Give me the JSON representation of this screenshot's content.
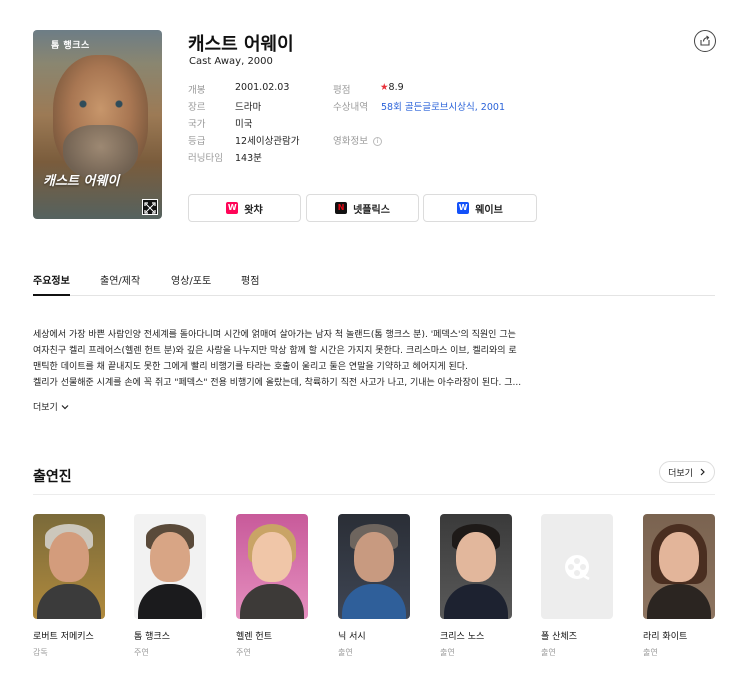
{
  "movie": {
    "title": "캐스트 어웨이",
    "subtitle": "Cast Away, 2000",
    "poster": {
      "top_text": "톰 행크스",
      "title_text": "캐스트 어웨이"
    },
    "info_left": [
      {
        "label": "개봉",
        "value": "2001.02.03"
      },
      {
        "label": "장르",
        "value": "드라마"
      },
      {
        "label": "국가",
        "value": "미국"
      },
      {
        "label": "등급",
        "value": "12세이상관람가"
      },
      {
        "label": "러닝타임",
        "value": "143분"
      }
    ],
    "info_right": {
      "rating_label": "평점",
      "rating_value": "8.9",
      "award_label": "수상내역",
      "award_value": "58회 골든글로브시상식, 2001",
      "movieinfo_label": "영화정보",
      "movieinfo_icon": "info-icon"
    }
  },
  "ott": [
    {
      "label": "왓챠",
      "logo": "W",
      "color": "#ff0558"
    },
    {
      "label": "넷플릭스",
      "logo": "N",
      "color": "#e50914"
    },
    {
      "label": "웨이브",
      "logo": "W",
      "color": "#1351f9"
    }
  ],
  "tabs": [
    "주요정보",
    "출연/제작",
    "영상/포토",
    "평점"
  ],
  "synopsis": {
    "lines": [
      "세상에서 가장 바쁜 사람인양 전세계를 돌아다니며 시간에 얽매여 살아가는 남자 척 놀랜드(톰 행크스 분). '페덱스'의 직원인 그는",
      "여자친구 켈리 프레어스(헬렌 헌트 분)와 깊은 사랑을 나누지만 막상 함께 할 시간은 가지지 못한다. 크리스마스 이브, 켈리와의 로",
      "맨틱한 데이트를 채 끝내지도 못한 그에게 빨리 비행기를 타라는 호출이 울리고 둘은 연말을 기약하고 헤어지게 된다.",
      "켈리가 선물해준 시계를 손에 꼭 쥐고 \"페덱스\" 전용 비행기에 올랐는데, 착륙하기 직전 사고가 나고, 기내는 아수라장이 된다. 그..."
    ],
    "more_label": "더보기"
  },
  "cast": {
    "heading": "출연진",
    "more_label": "더보기",
    "people": [
      {
        "name": "로버트 저메키스",
        "role": "감독"
      },
      {
        "name": "톰 행크스",
        "role": "주연"
      },
      {
        "name": "헬렌 헌트",
        "role": "주연"
      },
      {
        "name": "닉 서시",
        "role": "출연"
      },
      {
        "name": "크리스 노스",
        "role": "출연"
      },
      {
        "name": "폴 산체즈",
        "role": "출연"
      },
      {
        "name": "라리 화이트",
        "role": "출연"
      }
    ]
  }
}
